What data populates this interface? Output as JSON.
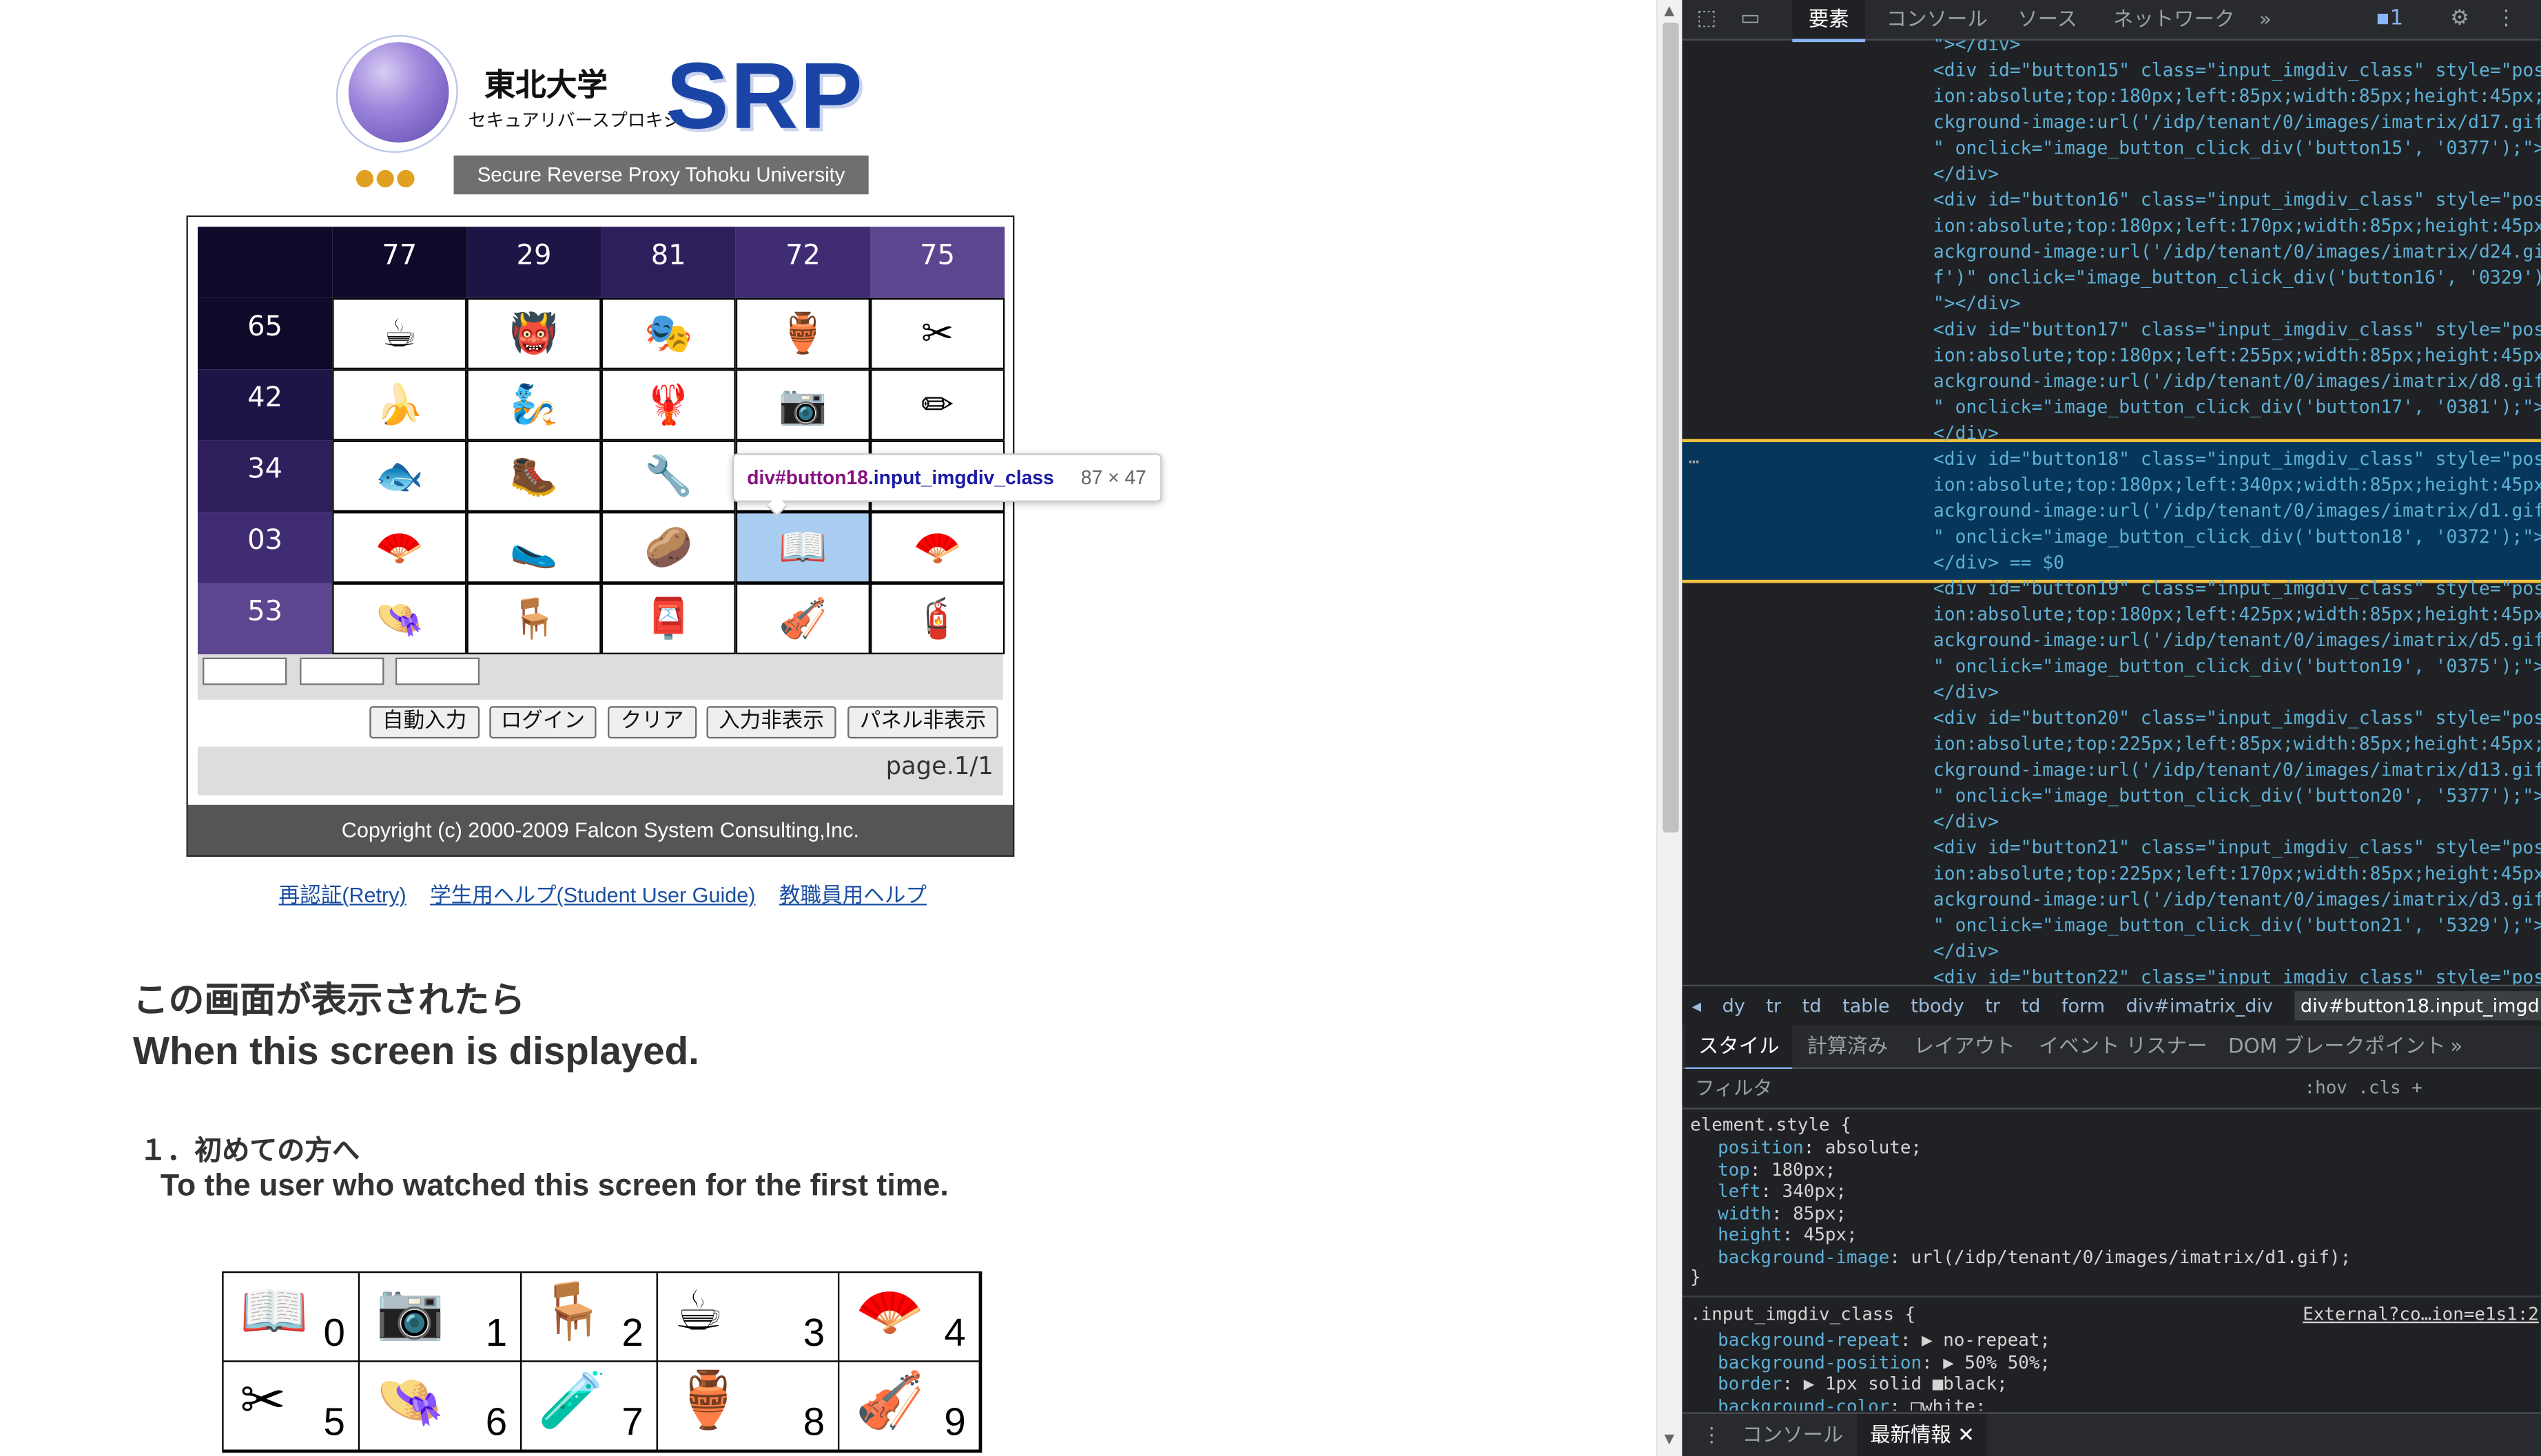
{
  "logo": {
    "university_jp": "東北大学",
    "university_kana": "セキュアリバースプロキシ",
    "brand": "SRP",
    "subtitle": "Secure Reverse Proxy Tohoku University"
  },
  "matrix": {
    "col_headers": [
      "77",
      "29",
      "81",
      "72",
      "75"
    ],
    "row_headers": [
      "65",
      "42",
      "34",
      "03",
      "53"
    ],
    "header_colors": [
      "#0d0a2a",
      "#1e1446",
      "#2e1e5c",
      "#3f2c72",
      "#5c4690"
    ],
    "cells": [
      [
        "☕",
        "👹",
        "🎭",
        "🏺",
        "✂"
      ],
      [
        "🍌",
        "🧞",
        "🦞",
        "📷",
        "✏"
      ],
      [
        "🐟",
        "🥾",
        "🔧",
        "⚪",
        "🧪"
      ],
      [
        "🪭",
        "🥿",
        "🥔",
        "📖",
        "🪭"
      ],
      [
        "👒",
        "🪑",
        "📮",
        "🎻",
        "🧯"
      ]
    ],
    "selected": "3-3"
  },
  "panel": {
    "buttons": [
      "自動入力",
      "ログイン",
      "クリア",
      "入力非表示",
      "パネル非表示"
    ],
    "page": "page.1/1",
    "copyright": "Copyright (c) 2000-2009 Falcon System Consulting,Inc."
  },
  "tooltip": {
    "tag": "div#button18",
    "klass": ".input_imgdiv_class",
    "dims": "87 × 47"
  },
  "links": [
    "再認証(Retry)",
    "学生用ヘルプ(Student User Guide)",
    "教職員用ヘルプ"
  ],
  "help": {
    "h1": "この画面が表示されたら",
    "h2": "When this screen is displayed.",
    "s1": "１．初めての方へ",
    "s2": "To the user who watched this screen for the first time."
  },
  "legend": [
    {
      "icon": "📖",
      "num": "0"
    },
    {
      "icon": "📷",
      "num": "1"
    },
    {
      "icon": "🪑",
      "num": "2"
    },
    {
      "icon": "☕",
      "num": "3"
    },
    {
      "icon": "🪭",
      "num": "4"
    },
    {
      "icon": "✂",
      "num": "5"
    },
    {
      "icon": "👒",
      "num": "6"
    },
    {
      "icon": "🧪",
      "num": "7"
    },
    {
      "icon": "🏺",
      "num": "8"
    },
    {
      "icon": "🎻",
      "num": "9"
    }
  ],
  "devtools": {
    "tabs": [
      "要素",
      "コンソール",
      "ソース",
      "ネットワーク",
      "»"
    ],
    "issues_badge": "1",
    "dom_lines": [
      "\"></div>",
      "<div id=\"button15\" class=\"input_imgdiv_class\" style=\"posit",
      "ion:absolute;top:180px;left:85px;width:85px;height:45px;ba",
      "ckground-image:url('/idp/tenant/0/images/imatrix/d17.gif')",
      "\" onclick=\"image_button_click_div('button15', '0377');\">",
      "</div>",
      "<div id=\"button16\" class=\"input_imgdiv_class\" style=\"posit",
      "ion:absolute;top:180px;left:170px;width:85px;height:45px;b",
      "ackground-image:url('/idp/tenant/0/images/imatrix/d24.gi",
      "f')\" onclick=\"image_button_click_div('button16', '0329');",
      "\"></div>",
      "<div id=\"button17\" class=\"input_imgdiv_class\" style=\"posit",
      "ion:absolute;top:180px;left:255px;width:85px;height:45px;b",
      "ackground-image:url('/idp/tenant/0/images/imatrix/d8.gif')",
      "\" onclick=\"image_button_click_div('button17', '0381');\">",
      "</div>",
      "<div id=\"button18\" class=\"input_imgdiv_class\" style=\"posit",
      "ion:absolute;top:180px;left:340px;width:85px;height:45px;b",
      "ackground-image:url('/idp/tenant/0/images/imatrix/d1.gif')",
      "\" onclick=\"image_button_click_div('button18', '0372');\">",
      "</div> == $0",
      "<div id=\"button19\" class=\"input_imgdiv_class\" style=\"posit",
      "ion:absolute;top:180px;left:425px;width:85px;height:45px;b",
      "ackground-image:url('/idp/tenant/0/images/imatrix/d5.gif')",
      "\" onclick=\"image_button_click_div('button19', '0375');\">",
      "</div>",
      "<div id=\"button20\" class=\"input_imgdiv_class\" style=\"posit",
      "ion:absolute;top:225px;left:85px;width:85px;height:45px;ba",
      "ckground-image:url('/idp/tenant/0/images/imatrix/d13.gif')",
      "\" onclick=\"image_button_click_div('button20', '5377');\">",
      "</div>",
      "<div id=\"button21\" class=\"input_imgdiv_class\" style=\"posit",
      "ion:absolute;top:225px;left:170px;width:85px;height:45px;b",
      "ackground-image:url('/idp/tenant/0/images/imatrix/d3.gif')",
      "\" onclick=\"image_button_click_div('button21', '5329');\">",
      "</div>",
      "<div id=\"button22\" class=\"input_imgdiv_class\" style=\"posit"
    ],
    "breadcrumbs": [
      "dy",
      "tr",
      "td",
      "table",
      "tbody",
      "tr",
      "td",
      "form",
      "div#imatrix_div",
      "div#button18.input_imgdiv_class"
    ],
    "style_tabs": [
      "スタイル",
      "計算済み",
      "レイアウト",
      "イベント リスナー",
      "DOM ブレークポイント",
      "»"
    ],
    "filter_placeholder": "フィルタ",
    "filter_tools": ":hov  .cls  +",
    "element_style_selector": "element.style {",
    "element_style": [
      {
        "prop": "position",
        "val": "absolute;"
      },
      {
        "prop": "top",
        "val": "180px;"
      },
      {
        "prop": "left",
        "val": "340px;"
      },
      {
        "prop": "width",
        "val": "85px;"
      },
      {
        "prop": "height",
        "val": "45px;"
      },
      {
        "prop": "background-image",
        "val": "url(/idp/tenant/0/images/imatrix/d1.gif);"
      }
    ],
    "rule2_selector": ".input_imgdiv_class {",
    "rule2_source": "External?co…ion=e1s1:2",
    "rule2": [
      {
        "prop": "background-repeat",
        "val": "▶ no-repeat;"
      },
      {
        "prop": "background-position",
        "val": "▶ 50% 50%;"
      },
      {
        "prop": "border",
        "val": "▶ 1px solid ■black;"
      },
      {
        "prop": "background-color",
        "val": "□white;"
      }
    ],
    "close_brace": "}",
    "drawer_tabs": [
      "コンソール",
      "最新情報"
    ]
  }
}
